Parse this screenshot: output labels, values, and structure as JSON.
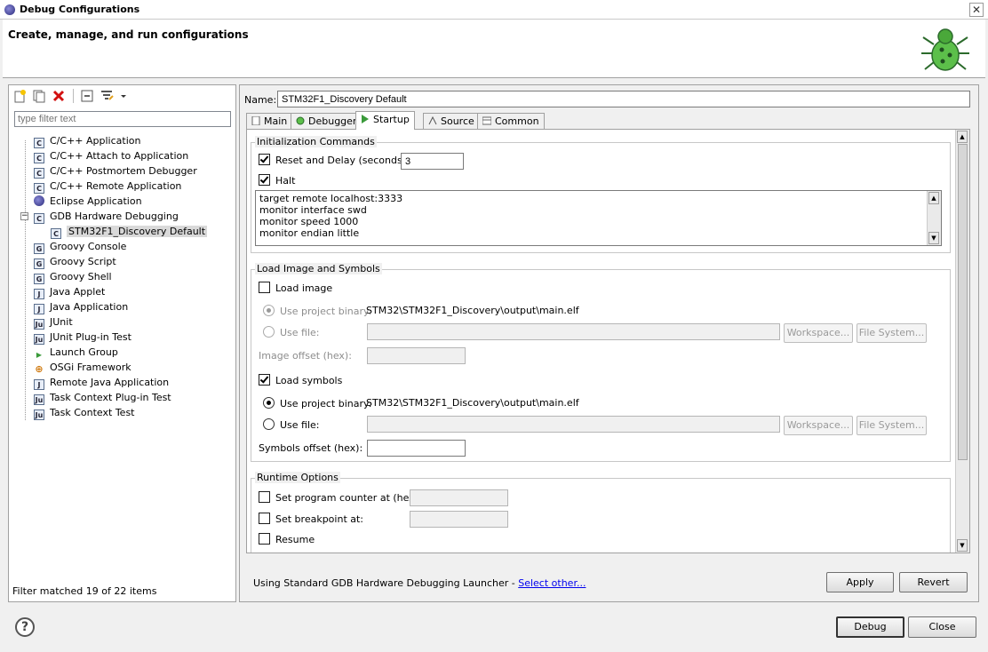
{
  "window": {
    "title": "Debug Configurations",
    "close": "✕"
  },
  "banner": {
    "heading": "Create, manage, and run configurations"
  },
  "left": {
    "filter_placeholder": "type filter text",
    "tree": [
      {
        "label": "C/C++ Application",
        "icon": "c-app-icon",
        "glyph": "C"
      },
      {
        "label": "C/C++ Attach to Application",
        "icon": "c-app-icon",
        "glyph": "C"
      },
      {
        "label": "C/C++ Postmortem Debugger",
        "icon": "c-app-icon",
        "glyph": "C"
      },
      {
        "label": "C/C++ Remote Application",
        "icon": "c-app-icon",
        "glyph": "C"
      },
      {
        "label": "Eclipse Application",
        "icon": "eclipse-icon",
        "glyph": ""
      },
      {
        "label": "GDB Hardware Debugging",
        "icon": "c-app-icon",
        "glyph": "C"
      },
      {
        "label": "STM32F1_Discovery Default",
        "icon": "c-config-icon",
        "glyph": "C"
      },
      {
        "label": "Groovy Console",
        "icon": "groovy-icon",
        "glyph": "G"
      },
      {
        "label": "Groovy Script",
        "icon": "groovy-icon",
        "glyph": "G"
      },
      {
        "label": "Groovy Shell",
        "icon": "groovy-icon",
        "glyph": "G"
      },
      {
        "label": "Java Applet",
        "icon": "java-applet-icon",
        "glyph": "J"
      },
      {
        "label": "Java Application",
        "icon": "java-app-icon",
        "glyph": "J"
      },
      {
        "label": "JUnit",
        "icon": "junit-icon",
        "glyph": "Ju"
      },
      {
        "label": "JUnit Plug-in Test",
        "icon": "junit-plugin-icon",
        "glyph": "Ju"
      },
      {
        "label": "Launch Group",
        "icon": "launch-group-icon",
        "glyph": "▶"
      },
      {
        "label": "OSGi Framework",
        "icon": "osgi-icon",
        "glyph": "⊕"
      },
      {
        "label": "Remote Java Application",
        "icon": "remote-java-icon",
        "glyph": "J"
      },
      {
        "label": "Task Context Plug-in Test",
        "icon": "task-plugin-icon",
        "glyph": "Ju"
      },
      {
        "label": "Task Context Test",
        "icon": "task-test-icon",
        "glyph": "Ju"
      }
    ],
    "filter_status": "Filter matched 19 of 22 items"
  },
  "right": {
    "name_label": "Name:",
    "name_value": "STM32F1_Discovery Default",
    "tabs": [
      "Main",
      "Debugger",
      "Startup",
      "Source",
      "Common"
    ],
    "active_tab": "Startup",
    "init": {
      "title": "Initialization Commands",
      "reset_label": "Reset and Delay (seconds):",
      "reset_checked": true,
      "delay_value": "3",
      "halt_label": "Halt",
      "halt_checked": true,
      "commands": [
        "target remote localhost:3333",
        "monitor interface swd",
        "monitor speed 1000",
        "monitor endian little"
      ]
    },
    "load": {
      "title": "Load Image and Symbols",
      "load_image_label": "Load image",
      "load_image_checked": false,
      "img_use_project_label": "Use project binary:",
      "img_project_binary": "STM32\\STM32F1_Discovery\\output\\main.elf",
      "img_use_file_label": "Use file:",
      "workspace_label": "Workspace...",
      "filesystem_label": "File System...",
      "image_offset_label": "Image offset (hex):",
      "load_symbols_label": "Load symbols",
      "load_symbols_checked": true,
      "sym_use_project_label": "Use project binary:",
      "sym_project_binary": "STM32\\STM32F1_Discovery\\output\\main.elf",
      "sym_use_file_label": "Use file:",
      "symbols_offset_label": "Symbols offset (hex):"
    },
    "runtime": {
      "title": "Runtime Options",
      "pc_label": "Set program counter at (hex):",
      "bp_label": "Set breakpoint at:",
      "resume_label": "Resume"
    },
    "launcher_text": "Using Standard GDB Hardware Debugging Launcher - ",
    "launcher_link": "Select other...",
    "apply_label": "Apply",
    "revert_label": "Revert"
  },
  "footer": {
    "help": "?",
    "debug_label": "Debug",
    "close_label": "Close"
  }
}
